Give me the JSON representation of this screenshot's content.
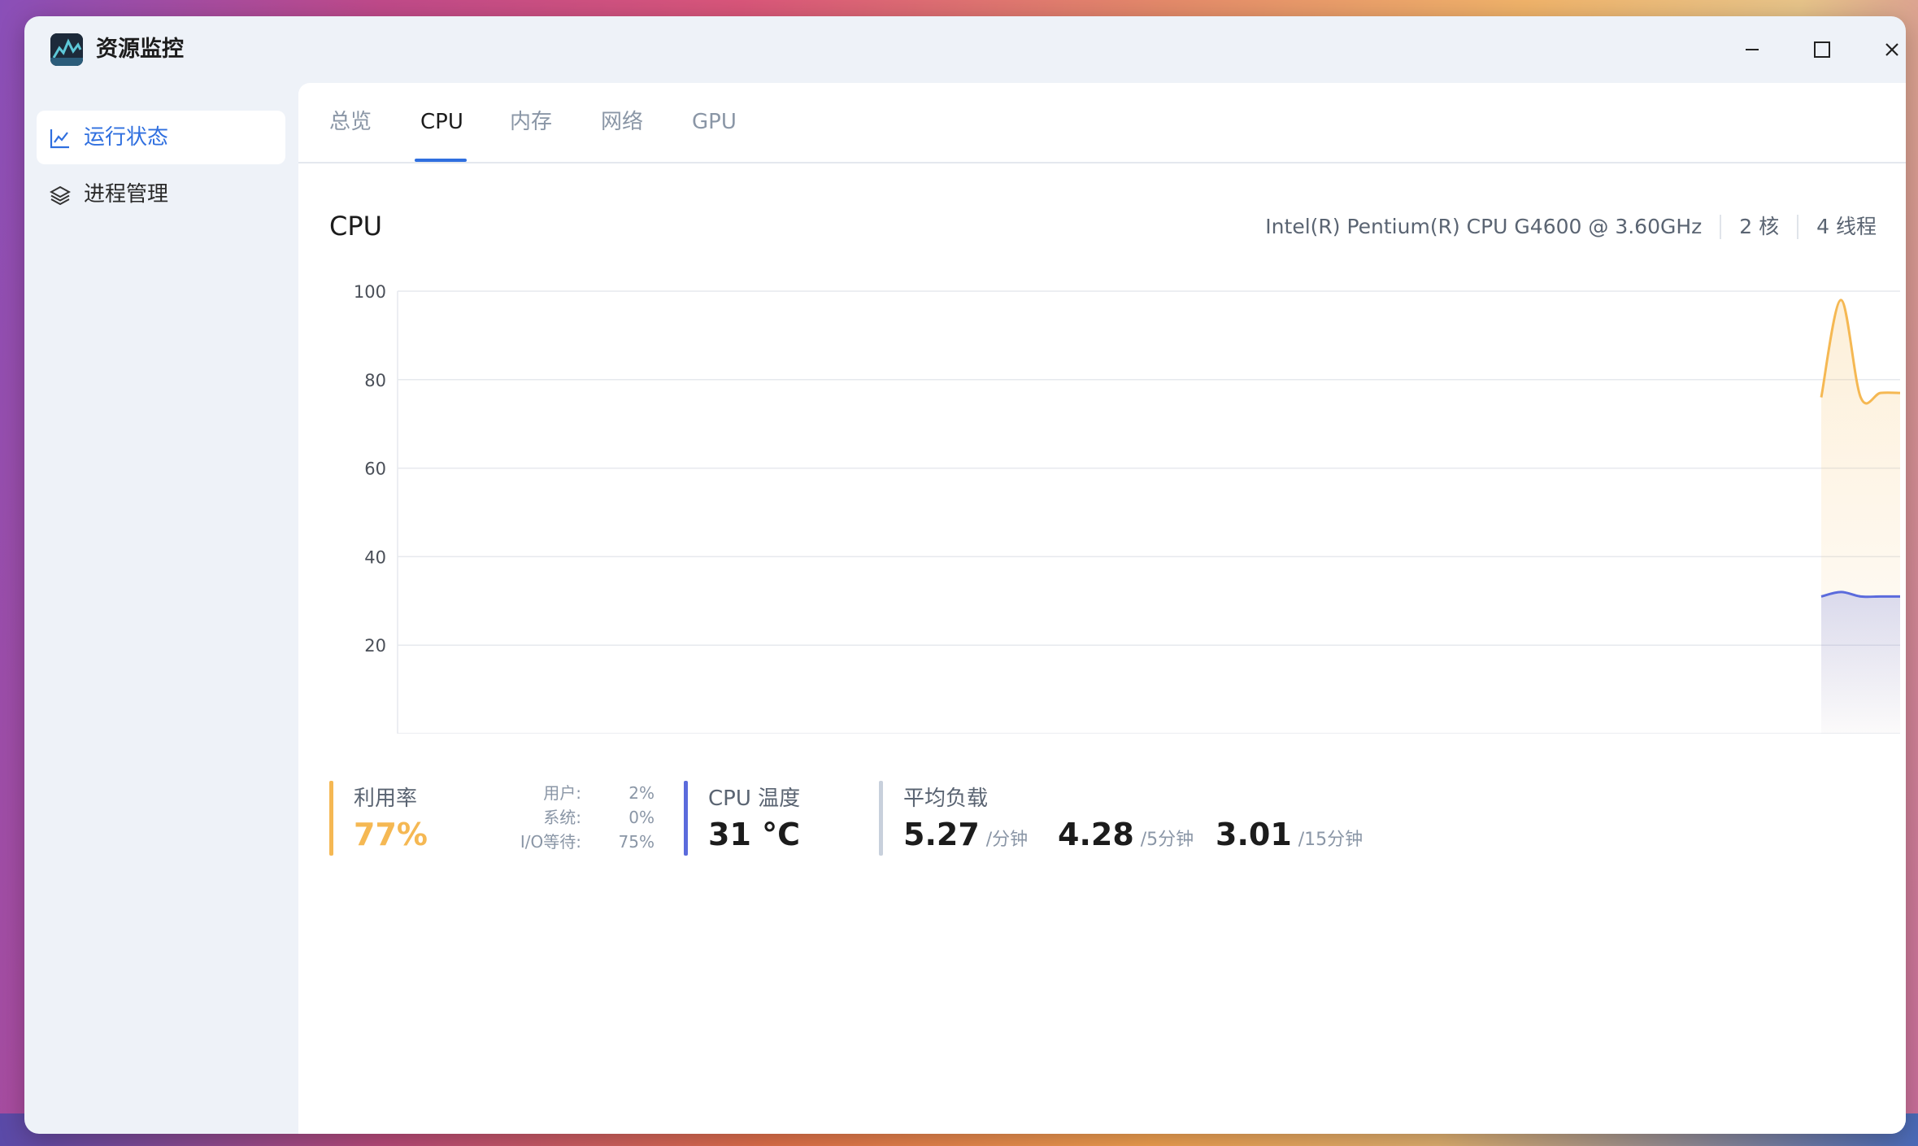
{
  "app": {
    "title": "资源监控"
  },
  "sidebar": {
    "items": [
      {
        "label": "运行状态",
        "icon": "line-chart-icon",
        "active": true
      },
      {
        "label": "进程管理",
        "icon": "layers-icon",
        "active": false
      }
    ]
  },
  "tabs": [
    {
      "label": "总览",
      "active": false
    },
    {
      "label": "CPU",
      "active": true
    },
    {
      "label": "内存",
      "active": false
    },
    {
      "label": "网络",
      "active": false
    },
    {
      "label": "GPU",
      "active": false
    }
  ],
  "cpu": {
    "title": "CPU",
    "model": "Intel(R) Pentium(R) CPU G4600 @ 3.60GHz",
    "cores": "2 核",
    "threads": "4 线程"
  },
  "chart_data": {
    "type": "area",
    "ylim": [
      0,
      100
    ],
    "y_ticks": [
      "100",
      "80",
      "60",
      "40",
      "20"
    ],
    "grid": true,
    "series": [
      {
        "color": "#f5b853",
        "x": [
          0,
          1,
          2,
          3,
          4
        ],
        "values": [
          76,
          98,
          76,
          77,
          77
        ]
      },
      {
        "color": "#5b6bdc",
        "x": [
          0,
          1,
          2,
          3,
          4
        ],
        "values": [
          31,
          32,
          31,
          31,
          31
        ]
      }
    ]
  },
  "stats": {
    "utilization": {
      "label": "利用率",
      "value": "77%",
      "color": "#f5b853"
    },
    "breakdown": [
      {
        "label": "用户:",
        "value": "2%"
      },
      {
        "label": "系统:",
        "value": "0%"
      },
      {
        "label": "I/O等待:",
        "value": "75%"
      }
    ],
    "temperature": {
      "label": "CPU 温度",
      "value": "31 °C",
      "color": "#5b6bdc"
    },
    "load": {
      "label": "平均负载",
      "color": "#c8d0dc",
      "items": [
        {
          "value": "5.27",
          "unit": "/分钟"
        },
        {
          "value": "4.28",
          "unit": "/5分钟"
        },
        {
          "value": "3.01",
          "unit": "/15分钟"
        }
      ]
    }
  }
}
